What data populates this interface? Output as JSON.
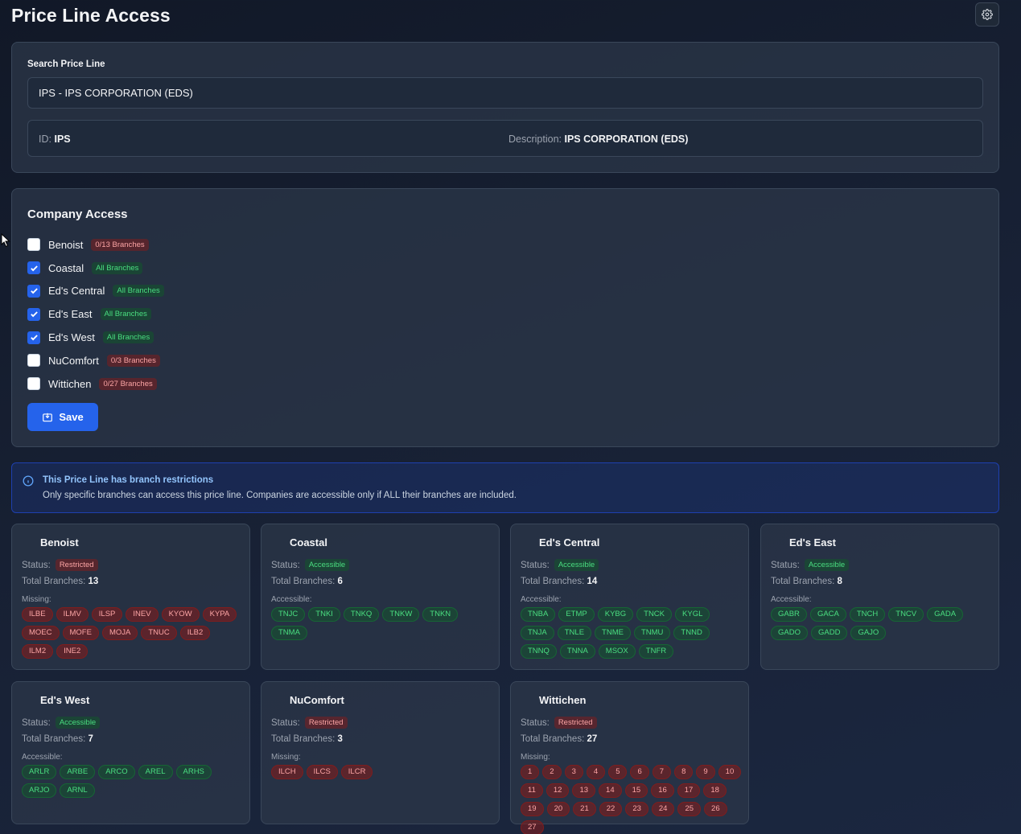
{
  "page": {
    "title": "Price Line Access"
  },
  "search": {
    "label": "Search Price Line",
    "value": "IPS - IPS CORPORATION (EDS)",
    "id_label": "ID:",
    "id_value": "IPS",
    "desc_label": "Description:",
    "desc_value": "IPS CORPORATION (EDS)"
  },
  "company_access": {
    "title": "Company Access",
    "save_label": "Save",
    "companies": [
      {
        "name": "Benoist",
        "checked": false,
        "badge": "0/13 Branches",
        "badge_color": "red"
      },
      {
        "name": "Coastal",
        "checked": true,
        "badge": "All Branches",
        "badge_color": "green"
      },
      {
        "name": "Ed's Central",
        "checked": true,
        "badge": "All Branches",
        "badge_color": "green"
      },
      {
        "name": "Ed's East",
        "checked": true,
        "badge": "All Branches",
        "badge_color": "green"
      },
      {
        "name": "Ed's West",
        "checked": true,
        "badge": "All Branches",
        "badge_color": "green"
      },
      {
        "name": "NuComfort",
        "checked": false,
        "badge": "0/3 Branches",
        "badge_color": "red"
      },
      {
        "name": "Wittichen",
        "checked": false,
        "badge": "0/27 Branches",
        "badge_color": "red"
      }
    ]
  },
  "notice": {
    "title": "This Price Line has branch restrictions",
    "body": "Only specific branches can access this price line. Companies are accessible only if ALL their branches are included."
  },
  "labels": {
    "status": "Status:",
    "total": "Total Branches:",
    "missing": "Missing:",
    "accessible": "Accessible:"
  },
  "cards": [
    {
      "name": "Benoist",
      "status": "Restricted",
      "status_color": "red",
      "total": "13",
      "list_type": "missing",
      "branches": [
        "ILBE",
        "ILMV",
        "ILSP",
        "INEV",
        "KYOW",
        "KYPA",
        "MOEC",
        "MOFE",
        "MOJA",
        "TNUC",
        "ILB2",
        "ILM2",
        "INE2"
      ]
    },
    {
      "name": "Coastal",
      "status": "Accessible",
      "status_color": "green",
      "total": "6",
      "list_type": "accessible",
      "branches": [
        "TNJC",
        "TNKI",
        "TNKQ",
        "TNKW",
        "TNKN",
        "TNMA"
      ]
    },
    {
      "name": "Ed's Central",
      "status": "Accessible",
      "status_color": "green",
      "total": "14",
      "list_type": "accessible",
      "branches": [
        "TNBA",
        "ETMP",
        "KYBG",
        "TNCK",
        "KYGL",
        "TNJA",
        "TNLE",
        "TNME",
        "TNMU",
        "TNND",
        "TNNQ",
        "TNNA",
        "MSOX",
        "TNFR"
      ]
    },
    {
      "name": "Ed's East",
      "status": "Accessible",
      "status_color": "green",
      "total": "8",
      "list_type": "accessible",
      "branches": [
        "GABR",
        "GACA",
        "TNCH",
        "TNCV",
        "GADA",
        "GADO",
        "GADD",
        "GAJO"
      ]
    },
    {
      "name": "Ed's West",
      "status": "Accessible",
      "status_color": "green",
      "total": "7",
      "list_type": "accessible",
      "branches": [
        "ARLR",
        "ARBE",
        "ARCO",
        "AREL",
        "ARHS",
        "ARJO",
        "ARNL"
      ]
    },
    {
      "name": "NuComfort",
      "status": "Restricted",
      "status_color": "red",
      "total": "3",
      "list_type": "missing",
      "branches": [
        "ILCH",
        "ILCS",
        "ILCR"
      ]
    },
    {
      "name": "Wittichen",
      "status": "Restricted",
      "status_color": "red",
      "total": "27",
      "list_type": "missing",
      "branches": [
        "1",
        "2",
        "3",
        "4",
        "5",
        "6",
        "7",
        "8",
        "9",
        "10",
        "11",
        "12",
        "13",
        "14",
        "15",
        "16",
        "17",
        "18",
        "19",
        "20",
        "21",
        "22",
        "23",
        "24",
        "25",
        "26",
        "27"
      ]
    }
  ]
}
